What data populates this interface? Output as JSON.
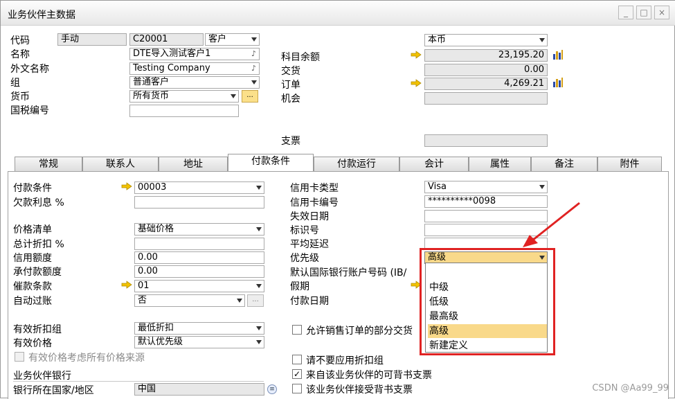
{
  "window": {
    "title": "业务伙伴主数据",
    "controls": {
      "minimize": "_",
      "maximize": "□",
      "close": "×"
    }
  },
  "header_left": {
    "code_label": "代码",
    "code_mode": "手动",
    "code_value": "C20001",
    "code_type": "客户",
    "name_label": "名称",
    "name_value": "DTE导入测试客户1",
    "foreign_name_label": "外文名称",
    "foreign_name_value": "Testing Company",
    "group_label": "组",
    "group_value": "普通客户",
    "currency_label": "货币",
    "currency_value": "所有货币",
    "currency_btn": "...",
    "tax_label": "国税编号",
    "tax_value": ""
  },
  "header_right": {
    "currency_select": "本币",
    "account_balance_label": "科目余额",
    "account_balance_value": "23,195.20",
    "delivery_label": "交货",
    "delivery_value": "0.00",
    "order_label": "订单",
    "order_value": "4,269.21",
    "opportunity_label": "机会",
    "opportunity_value": "",
    "check_label": "支票",
    "check_value": ""
  },
  "tabs": [
    {
      "label": "常规"
    },
    {
      "label": "联系人"
    },
    {
      "label": "地址"
    },
    {
      "label": "付款条件",
      "active": true
    },
    {
      "label": "付款运行"
    },
    {
      "label": "会计"
    },
    {
      "label": "属性"
    },
    {
      "label": "备注"
    },
    {
      "label": "附件"
    }
  ],
  "payment_left": {
    "payment_terms_label": "付款条件",
    "payment_terms_value": "00003",
    "interest_label": "欠款利息 %",
    "interest_value": "",
    "price_list_label": "价格清单",
    "price_list_value": "基础价格",
    "total_discount_label": "总计折扣 %",
    "total_discount_value": "",
    "credit_limit_label": "信用额度",
    "credit_limit_value": "0.00",
    "commitment_label": "承付款额度",
    "commitment_value": "0.00",
    "dunning_label": "催款条款",
    "dunning_value": "01",
    "auto_post_label": "自动过账",
    "auto_post_value": "否",
    "eff_discount_label": "有效折扣组",
    "eff_discount_value": "最低折扣",
    "eff_price_label": "有效价格",
    "eff_price_value": "默认优先级",
    "consider_all_label": "有效价格考虑所有价格来源",
    "partner_bank_label": "业务伙伴银行",
    "bank_country_label": "银行所在国家/地区",
    "bank_country_value": "中国"
  },
  "payment_right": {
    "card_type_label": "信用卡类型",
    "card_type_value": "Visa",
    "card_number_label": "信用卡编号",
    "card_number_value": "**********0098",
    "expiry_label": "失效日期",
    "id_label": "标识号",
    "avg_delay_label": "平均延迟",
    "priority_label": "优先级",
    "priority_value": "高级",
    "iban_label": "默认国际银行账户号码 (IB/",
    "holiday_label": "假期",
    "payment_date_label": "付款日期",
    "partial_delivery_label": "允许销售订单的部分交货",
    "no_discount_label": "请不要应用折扣组",
    "endorsed_checks_from_label": "来自该业务伙伴的可背书支票",
    "accept_endorsed_label": "该业务伙伴接受背书支票"
  },
  "priority_options": [
    "",
    "中级",
    "低级",
    "最高级",
    "高级",
    "新建定义"
  ],
  "priority_selected_index": 4,
  "watermark": "CSDN @Aa99_99",
  "colors": {
    "highlight": "#f9d98a",
    "annotation_red": "#e02222",
    "link_arrow": "#f2c200"
  }
}
